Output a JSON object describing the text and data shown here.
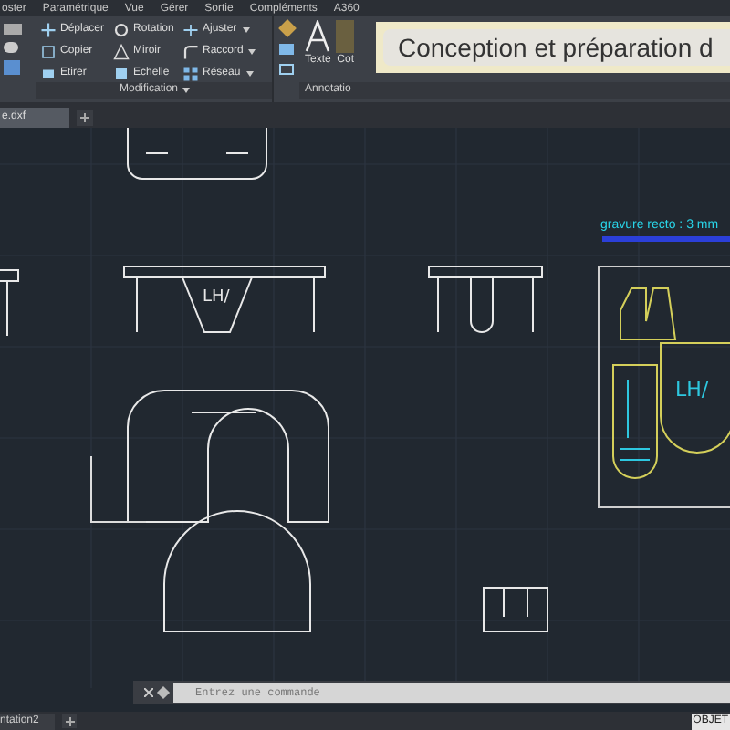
{
  "menu": [
    "oster",
    "Paramétrique",
    "Vue",
    "Gérer",
    "Sortie",
    "Compléments",
    "A360"
  ],
  "ribbon": {
    "tools": [
      {
        "label": "Déplacer",
        "dropdown": false
      },
      {
        "label": "Rotation",
        "dropdown": false
      },
      {
        "label": "Ajuster",
        "dropdown": true
      },
      {
        "label": "Copier",
        "dropdown": false
      },
      {
        "label": "Miroir",
        "dropdown": false
      },
      {
        "label": "Raccord",
        "dropdown": true
      },
      {
        "label": "Etirer",
        "dropdown": false
      },
      {
        "label": "Echelle",
        "dropdown": false
      },
      {
        "label": "Réseau",
        "dropdown": true
      }
    ],
    "panels": [
      "Modification",
      "Annotatio"
    ],
    "big_tools": [
      "Texte",
      "Cot"
    ]
  },
  "caption": "Conception et préparation d",
  "tabs": [
    {
      "label": "e.dxf",
      "selected": true
    }
  ],
  "drawing": {
    "note": "gravure recto : 3 mm",
    "logo_texts": [
      "LH/",
      "LH/"
    ]
  },
  "command": {
    "placeholder": "Entrez une commande"
  },
  "layout_tabs": [
    {
      "label": "ntation2",
      "selected": false
    }
  ],
  "status": "OBJET"
}
